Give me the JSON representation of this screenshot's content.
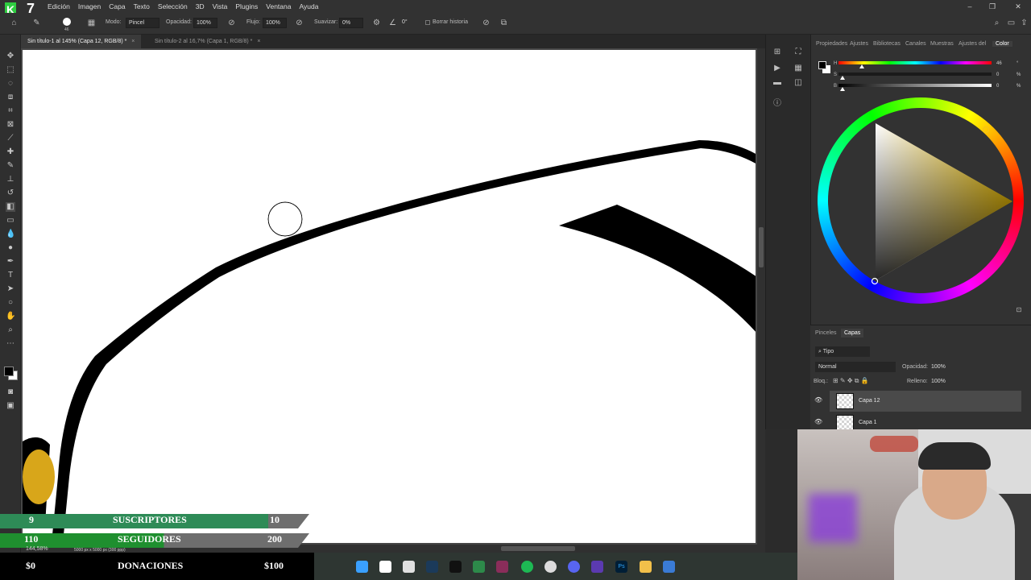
{
  "menu": [
    "Edición",
    "Imagen",
    "Capa",
    "Texto",
    "Selección",
    "3D",
    "Vista",
    "Plugins",
    "Ventana",
    "Ayuda"
  ],
  "stream_badge": "7",
  "options": {
    "brush_size": "46",
    "mode_label": "Modo:",
    "mode_value": "Pincel",
    "opacity_label": "Opacidad:",
    "opacity_value": "100%",
    "flow_label": "Flujo:",
    "flow_value": "100%",
    "smooth_label": "Suavizar:",
    "smooth_value": "0%",
    "angle_value": "0°",
    "erase_history_label": "Borrar historia"
  },
  "tabs": [
    {
      "label": "Sin título-1 al 145% (Capa 12, RGB/8) *",
      "close": "×"
    },
    {
      "label": "Sin título-2 al 16,7% (Capa 1, RGB/8) *",
      "close": "×"
    }
  ],
  "status": {
    "zoom": "144,58%",
    "doc_info": "5000 px x 5000 px (300 ppp)"
  },
  "color_panel": {
    "tabs": [
      "Propiedades",
      "Ajustes",
      "Bibliotecas",
      "Canales",
      "Muestras",
      "Ajustes del",
      "Color"
    ],
    "active_tab": "Color",
    "h_label": "H",
    "h_value": "46",
    "h_unit": "°",
    "s_label": "S",
    "s_value": "0",
    "s_unit": "%",
    "b_label": "B",
    "b_value": "0",
    "b_unit": "%",
    "hue_marker_color": "#f5c518",
    "triangle_color": "#f5c400"
  },
  "layers_panel": {
    "tabs": [
      "Pinceles",
      "Capas"
    ],
    "active_tab": "Capas",
    "filter_label": "Tipo",
    "blend_mode": "Normal",
    "opacity_label": "Opacidad:",
    "opacity_value": "100%",
    "lock_label": "Bloq.:",
    "fill_label": "Relleno:",
    "fill_value": "100%",
    "layers": [
      {
        "name": "Capa 12",
        "selected": true
      },
      {
        "name": "Capa 1",
        "selected": false
      }
    ]
  },
  "overlay": {
    "rows": [
      {
        "left": "9",
        "label": "SUSCRIPTORES",
        "right": "10",
        "progress": 0.9,
        "color": "#2e8b57"
      },
      {
        "left": "110",
        "label": "SEGUIDORES",
        "right": "200",
        "progress": 0.55,
        "color": "#1f8f2f"
      },
      {
        "left": "$0",
        "label": "DONACIONES",
        "right": "$100",
        "progress": 0.0,
        "color": "#555555"
      }
    ]
  },
  "taskbar_icons": [
    "windows-icon",
    "search-icon",
    "store-icon",
    "steam-icon",
    "tiktok-icon",
    "app-icon",
    "app-icon",
    "spotify-icon",
    "chrome-icon",
    "discord-icon",
    "app-icon",
    "photoshop-icon",
    "folder-icon",
    "app-icon"
  ]
}
